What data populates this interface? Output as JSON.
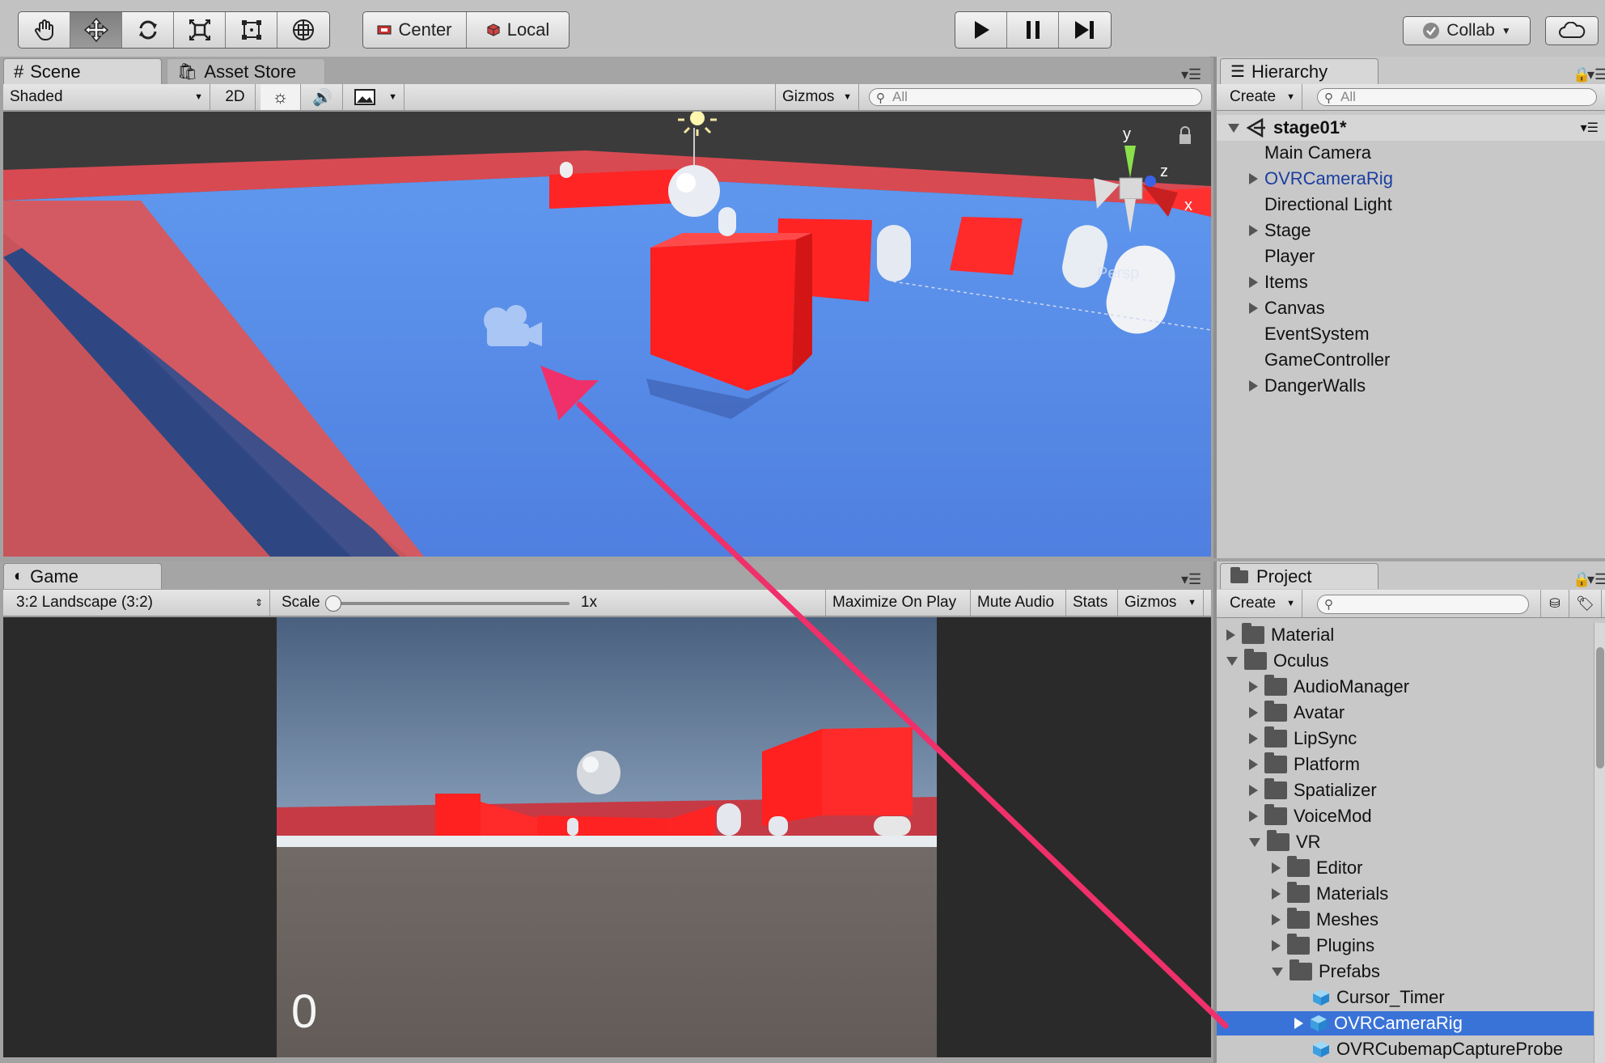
{
  "toolbar": {
    "tools": [
      "hand-tool",
      "move-tool",
      "rotate-tool",
      "scale-tool",
      "rect-tool",
      "transform-tool"
    ],
    "pivot_label": "Center",
    "space_label": "Local",
    "collab_label": "Collab"
  },
  "scene": {
    "tab_label": "Scene",
    "asset_store_label": "Asset Store",
    "shading_mode": "Shaded",
    "two_d_label": "2D",
    "gizmos_label": "Gizmos",
    "search_placeholder": "All",
    "persp_label": "Persp",
    "axis_y": "y",
    "axis_z": "z",
    "axis_x": "x"
  },
  "game": {
    "tab_label": "Game",
    "aspect_label": "3:2 Landscape (3:2)",
    "scale_label": "Scale",
    "scale_value": "1x",
    "scale_slider_fraction": 0.0,
    "maximize_label": "Maximize On Play",
    "mute_label": "Mute Audio",
    "stats_label": "Stats",
    "gizmos_label": "Gizmos",
    "score": "0"
  },
  "hierarchy": {
    "tab_label": "Hierarchy",
    "create_label": "Create",
    "search_placeholder": "All",
    "scene_name": "stage01*",
    "items": [
      {
        "label": "Main Camera",
        "expandable": false,
        "prefab": false
      },
      {
        "label": "OVRCameraRig",
        "expandable": true,
        "prefab": true
      },
      {
        "label": "Directional Light",
        "expandable": false,
        "prefab": false
      },
      {
        "label": "Stage",
        "expandable": true,
        "prefab": false
      },
      {
        "label": "Player",
        "expandable": false,
        "prefab": false
      },
      {
        "label": "Items",
        "expandable": true,
        "prefab": false
      },
      {
        "label": "Canvas",
        "expandable": true,
        "prefab": false
      },
      {
        "label": "EventSystem",
        "expandable": false,
        "prefab": false
      },
      {
        "label": "GameController",
        "expandable": false,
        "prefab": false
      },
      {
        "label": "DangerWalls",
        "expandable": true,
        "prefab": false
      }
    ]
  },
  "project": {
    "tab_label": "Project",
    "create_label": "Create",
    "items": [
      {
        "label": "Material",
        "depth": 0,
        "state": "collapsed",
        "kind": "folder"
      },
      {
        "label": "Oculus",
        "depth": 0,
        "state": "expanded",
        "kind": "folder"
      },
      {
        "label": "AudioManager",
        "depth": 1,
        "state": "collapsed",
        "kind": "folder"
      },
      {
        "label": "Avatar",
        "depth": 1,
        "state": "collapsed",
        "kind": "folder"
      },
      {
        "label": "LipSync",
        "depth": 1,
        "state": "collapsed",
        "kind": "folder"
      },
      {
        "label": "Platform",
        "depth": 1,
        "state": "collapsed",
        "kind": "folder"
      },
      {
        "label": "Spatializer",
        "depth": 1,
        "state": "collapsed",
        "kind": "folder"
      },
      {
        "label": "VoiceMod",
        "depth": 1,
        "state": "collapsed",
        "kind": "folder"
      },
      {
        "label": "VR",
        "depth": 1,
        "state": "expanded",
        "kind": "folder"
      },
      {
        "label": "Editor",
        "depth": 2,
        "state": "collapsed",
        "kind": "folder"
      },
      {
        "label": "Materials",
        "depth": 2,
        "state": "collapsed",
        "kind": "folder"
      },
      {
        "label": "Meshes",
        "depth": 2,
        "state": "collapsed",
        "kind": "folder"
      },
      {
        "label": "Plugins",
        "depth": 2,
        "state": "collapsed",
        "kind": "folder"
      },
      {
        "label": "Prefabs",
        "depth": 2,
        "state": "expanded",
        "kind": "folder"
      },
      {
        "label": "Cursor_Timer",
        "depth": 3,
        "state": "none",
        "kind": "prefab"
      },
      {
        "label": "OVRCameraRig",
        "depth": 3,
        "state": "collapsed",
        "kind": "prefab",
        "selected": true
      },
      {
        "label": "OVRCubemapCaptureProbe",
        "depth": 3,
        "state": "none",
        "kind": "prefab"
      }
    ]
  },
  "colors": {
    "selection": "#3a73d8",
    "prefab_text": "#1b3fa0",
    "arrow": "#f0306a",
    "floor": "#5b8de6",
    "walls": "#ff2a2a"
  }
}
